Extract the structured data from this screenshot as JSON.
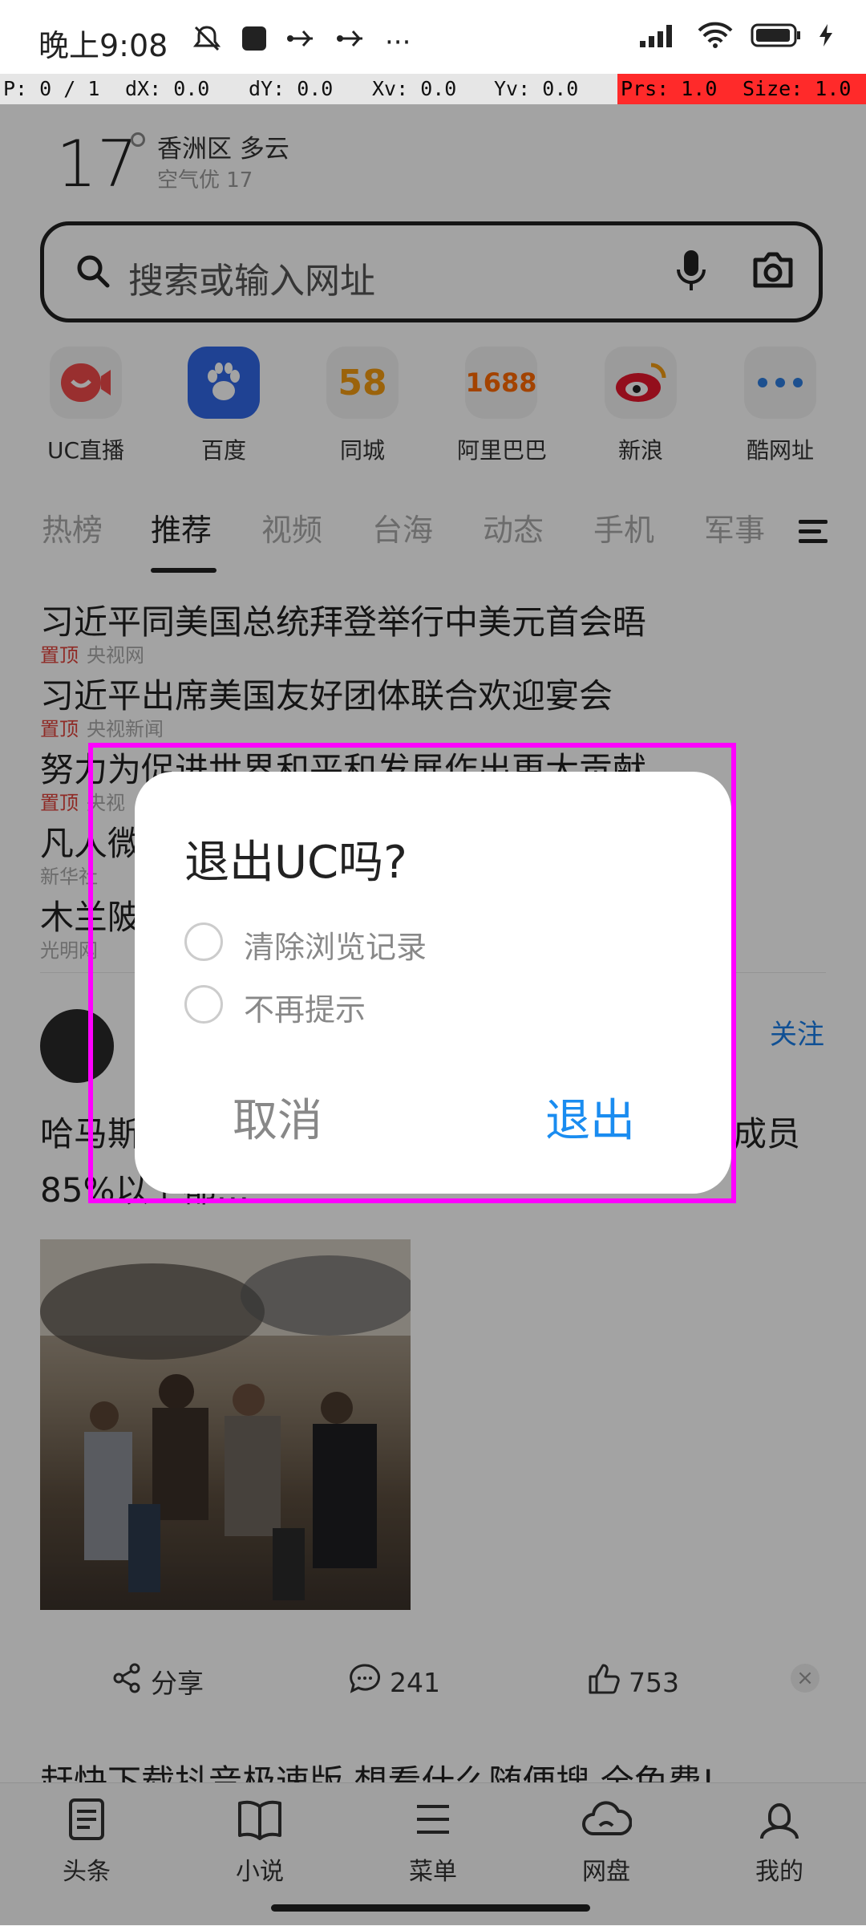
{
  "status_bar": {
    "time": "晚上9:08",
    "more": "···"
  },
  "debug": {
    "p": "P: 0 / 1",
    "dx": "dX: 0.0",
    "dy": "dY: 0.0",
    "xv": "Xv: 0.0",
    "yv": "Yv: 0.0",
    "prs": "Prs: 1.0",
    "size": "Size: 1.0"
  },
  "weather": {
    "temp": "17",
    "location": "香洲区 多云",
    "air": "空气优 17"
  },
  "search": {
    "placeholder": "搜索或输入网址"
  },
  "shortcuts": [
    {
      "label": "UC直播",
      "icon": "uc-live-icon"
    },
    {
      "label": "百度",
      "icon": "baidu-paw-icon"
    },
    {
      "label": "同城",
      "icon": "58-icon",
      "glyph": "58"
    },
    {
      "label": "阿里巴巴",
      "icon": "1688-icon",
      "glyph": "1688"
    },
    {
      "label": "新浪",
      "icon": "sina-eye-icon"
    },
    {
      "label": "酷网址",
      "icon": "more-dots-icon"
    }
  ],
  "tabs": [
    "热榜",
    "推荐",
    "视频",
    "台海",
    "动态",
    "手机",
    "军事"
  ],
  "headlines": [
    {
      "title": "习近平同美国总统拜登举行中美元首会晤",
      "pin": "置顶",
      "source": "央视网"
    },
    {
      "title": "习近平出席美国友好团体联合欢迎宴会",
      "pin": "置顶",
      "source": "央视新闻"
    },
    {
      "title": "努力为促进世界和平和发展作出更大贡献",
      "pin": "置顶",
      "source": "央视"
    },
    {
      "title": "凡人微",
      "pin": "",
      "source": "新华社"
    },
    {
      "title": "木兰陂",
      "pin": "",
      "source": "光明网"
    }
  ],
  "feed": {
    "follow": "关注",
    "text_line1_left": "哈马斯",
    "text_line1_right": "成员",
    "text_line2": "85%以上都…",
    "share": "分享",
    "comments": "241",
    "likes": "753",
    "close": "×",
    "next_title": "赶快下载抖音极速版 想看什么随便搜 全免费!"
  },
  "bottom_nav": [
    {
      "label": "头条",
      "icon": "news-icon"
    },
    {
      "label": "小说",
      "icon": "book-icon"
    },
    {
      "label": "菜单",
      "icon": "menu-icon"
    },
    {
      "label": "网盘",
      "icon": "cloud-icon"
    },
    {
      "label": "我的",
      "icon": "profile-icon"
    }
  ],
  "dialog": {
    "title": "退出UC吗?",
    "option1": "清除浏览记录",
    "option2": "不再提示",
    "cancel": "取消",
    "exit": "退出"
  },
  "colors": {
    "accent": "#1a8cf0",
    "highlight_outline": "#ff00ff",
    "pin": "#e0433b"
  }
}
